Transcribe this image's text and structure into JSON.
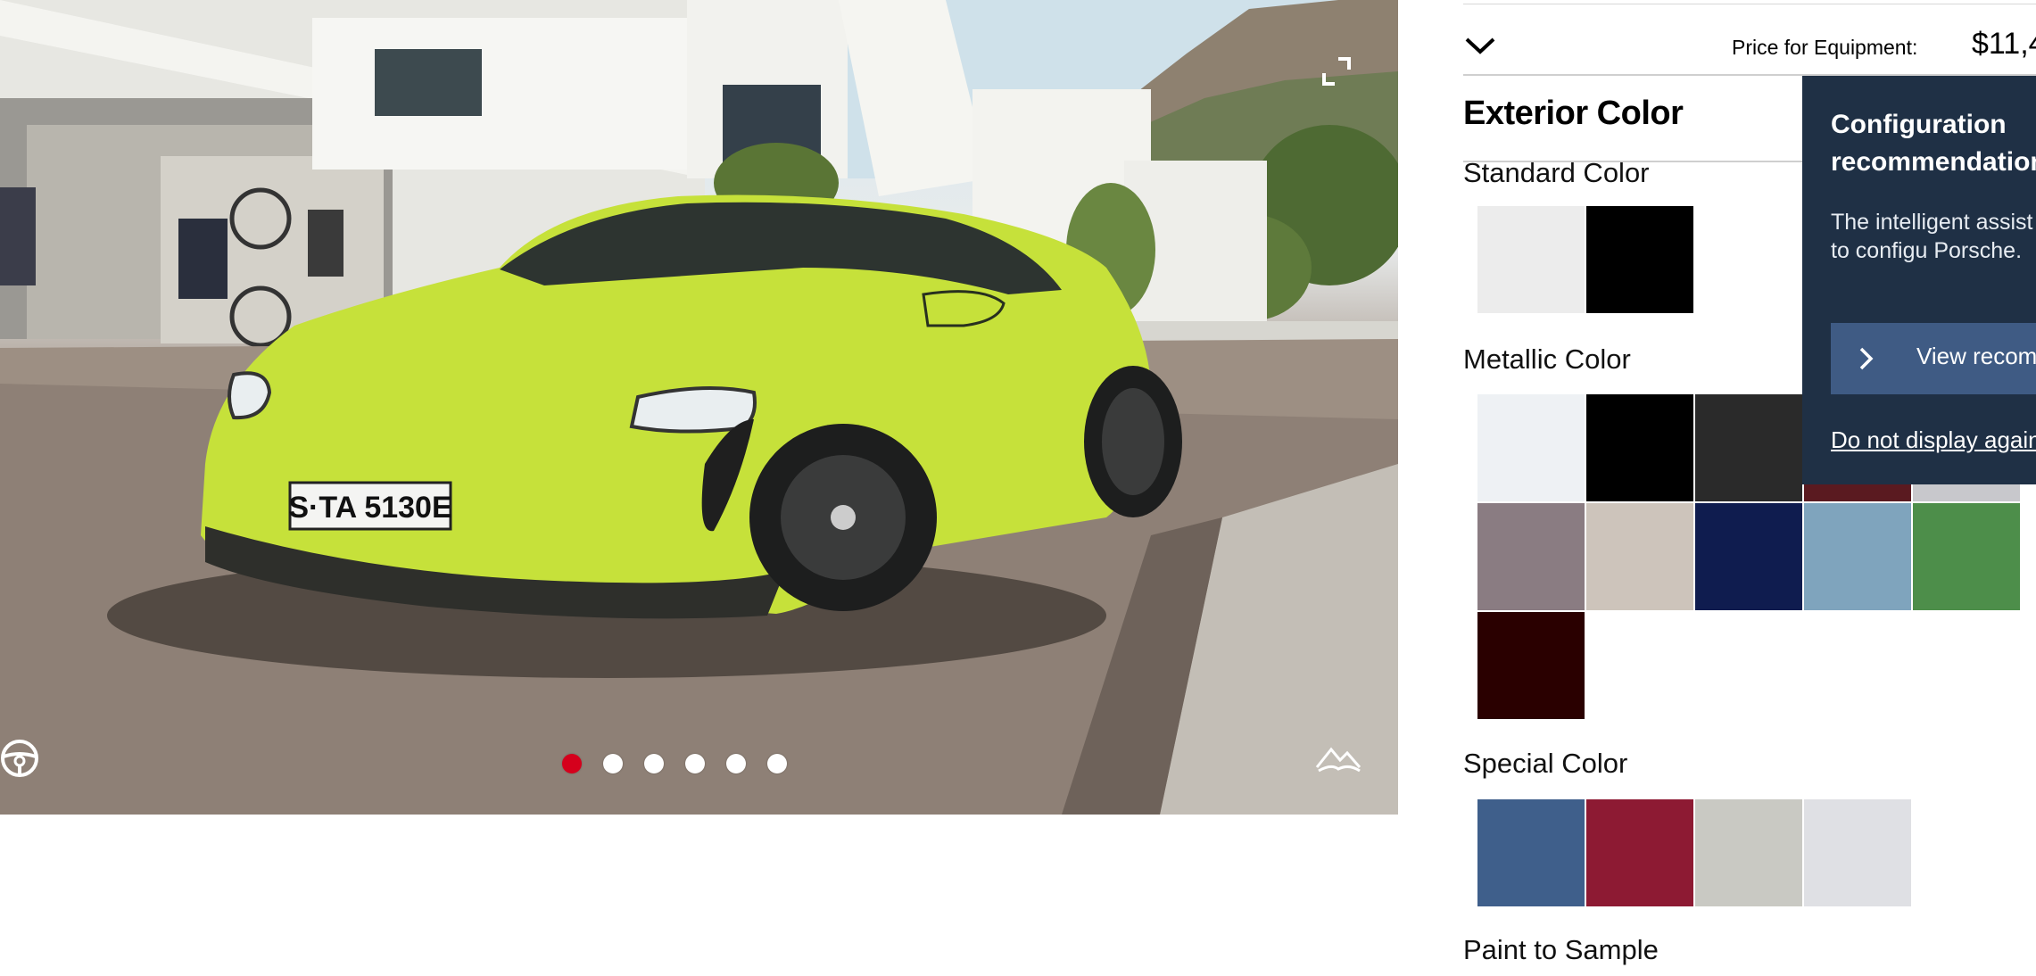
{
  "viewer": {
    "plate_text": "S·TA 5130E",
    "active_slide": 1,
    "slides": [
      1,
      2,
      3,
      4,
      5,
      6
    ],
    "car_color": "#c6e13a",
    "expand_icon": "expand-icon",
    "interior_view_icon": "steering-wheel-icon",
    "scene_icon": "landscape-icon"
  },
  "price_bar": {
    "label": "Price for Equipment:",
    "value": "$11,4"
  },
  "exterior": {
    "title": "Exterior Color",
    "groups": {
      "standard": {
        "label": "Standard Color",
        "swatches": [
          "#ececec",
          "#000000"
        ]
      },
      "metallic": {
        "label": "Metallic Color",
        "swatches": [
          "#eef1f4",
          "#000000",
          "#2a2a2a",
          "#5a1a20",
          "#c8c8cc",
          "#8a7c82",
          "#cdc4bb",
          "#0f1c4f",
          "#7fa4bd",
          "#4d8e4a",
          "#2a0000"
        ]
      },
      "special": {
        "label": "Special Color",
        "swatches": [
          "#3f5f8b",
          "#8d1a33",
          "#c9c9c3",
          "#dfe0e4"
        ]
      },
      "paint_to_sample": {
        "label": "Paint to Sample"
      }
    }
  },
  "popover": {
    "title": "Configuration recommendations",
    "body": "The intelligent assist inspiration to configu Porsche.",
    "button_label": "View recomm",
    "link_label": "Do not display again"
  },
  "colors": {
    "accent_red": "#d5001c",
    "popover_bg": "#1f3045",
    "popover_button": "#3f5b84"
  }
}
